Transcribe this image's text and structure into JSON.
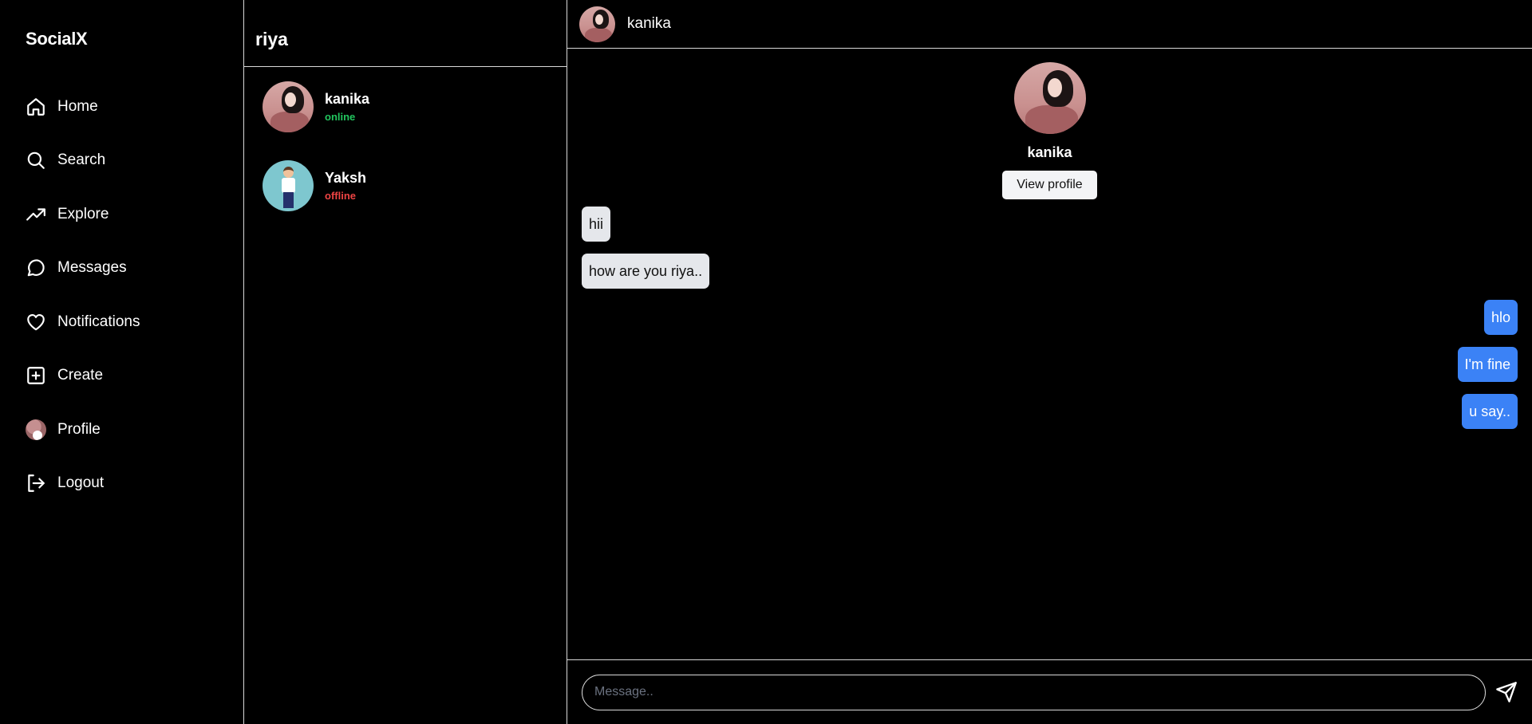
{
  "brand": "SocialX",
  "nav": {
    "items": [
      {
        "label": "Home",
        "icon": "home-icon"
      },
      {
        "label": "Search",
        "icon": "search-icon"
      },
      {
        "label": "Explore",
        "icon": "trending-icon"
      },
      {
        "label": "Messages",
        "icon": "chat-icon"
      },
      {
        "label": "Notifications",
        "icon": "heart-icon"
      },
      {
        "label": "Create",
        "icon": "plus-square-icon"
      },
      {
        "label": "Profile",
        "icon": "avatar"
      },
      {
        "label": "Logout",
        "icon": "logout-icon"
      }
    ]
  },
  "conversations": {
    "user": "riya",
    "list": [
      {
        "name": "kanika",
        "status": "online"
      },
      {
        "name": "Yaksh",
        "status": "offline"
      }
    ]
  },
  "chat": {
    "header_name": "kanika",
    "profile": {
      "name": "kanika",
      "button": "View profile"
    },
    "messages": [
      {
        "text": "hii",
        "from": "them"
      },
      {
        "text": "how are you riya..",
        "from": "them"
      },
      {
        "text": "hlo",
        "from": "me"
      },
      {
        "text": "I'm fine",
        "from": "me"
      },
      {
        "text": "u say..",
        "from": "me"
      }
    ],
    "composer": {
      "placeholder": "Message.."
    }
  },
  "colors": {
    "online": "#22c55e",
    "offline": "#ef4444",
    "outgoing": "#3b82f6",
    "incoming": "#e5e7eb"
  }
}
